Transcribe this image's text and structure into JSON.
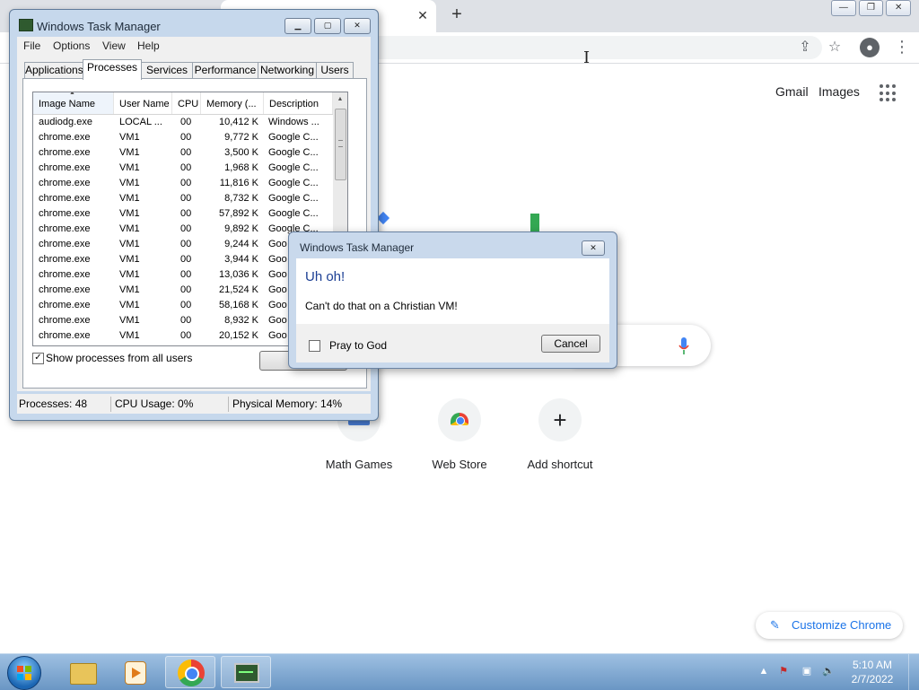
{
  "chrome": {
    "tab_close": "✕",
    "new_tab": "+",
    "window_controls": [
      "—",
      "❐",
      "✕"
    ],
    "links": {
      "gmail": "Gmail",
      "images": "Images"
    },
    "shortcuts": [
      {
        "label": "Math Games",
        "icon": "math-games-icon"
      },
      {
        "label": "Web Store",
        "icon": "web-store-icon"
      },
      {
        "label": "Add shortcut",
        "icon": "plus-icon",
        "glyph": "+"
      }
    ],
    "customize_label": "Customize Chrome",
    "colors": {
      "link_blue": "#1a73e8",
      "google_blue": "#4285f4",
      "google_green": "#34a853"
    }
  },
  "task_manager": {
    "title": "Windows Task Manager",
    "menu": [
      "File",
      "Options",
      "View",
      "Help"
    ],
    "tabs": [
      "Applications",
      "Processes",
      "Services",
      "Performance",
      "Networking",
      "Users"
    ],
    "active_tab": "Processes",
    "columns": [
      "Image Name",
      "User Name",
      "CPU",
      "Memory (...",
      "Description"
    ],
    "rows": [
      [
        "audiodg.exe",
        "LOCAL ...",
        "00",
        "10,412 K",
        "Windows ..."
      ],
      [
        "chrome.exe",
        "VM1",
        "00",
        "9,772 K",
        "Google C..."
      ],
      [
        "chrome.exe",
        "VM1",
        "00",
        "3,500 K",
        "Google C..."
      ],
      [
        "chrome.exe",
        "VM1",
        "00",
        "1,968 K",
        "Google C..."
      ],
      [
        "chrome.exe",
        "VM1",
        "00",
        "11,816 K",
        "Google C..."
      ],
      [
        "chrome.exe",
        "VM1",
        "00",
        "8,732 K",
        "Google C..."
      ],
      [
        "chrome.exe",
        "VM1",
        "00",
        "57,892 K",
        "Google C..."
      ],
      [
        "chrome.exe",
        "VM1",
        "00",
        "9,892 K",
        "Google C..."
      ],
      [
        "chrome.exe",
        "VM1",
        "00",
        "9,244 K",
        "Goo"
      ],
      [
        "chrome.exe",
        "VM1",
        "00",
        "3,944 K",
        "Goo"
      ],
      [
        "chrome.exe",
        "VM1",
        "00",
        "13,036 K",
        "Goo"
      ],
      [
        "chrome.exe",
        "VM1",
        "00",
        "21,524 K",
        "Goo"
      ],
      [
        "chrome.exe",
        "VM1",
        "00",
        "58,168 K",
        "Goo"
      ],
      [
        "chrome.exe",
        "VM1",
        "00",
        "8,932 K",
        "Goo"
      ],
      [
        "chrome.exe",
        "VM1",
        "00",
        "20,152 K",
        "Goo"
      ]
    ],
    "show_all_label": "Show processes from all users",
    "show_all_checked": true,
    "end_button": "En",
    "status": {
      "processes": "Processes: 48",
      "cpu": "CPU Usage: 0%",
      "memory": "Physical Memory: 14%"
    }
  },
  "dialog": {
    "title": "Windows Task Manager",
    "heading": "Uh oh!",
    "message": "Can't do that on a Christian VM!",
    "checkbox_label": "Pray to God",
    "cancel_label": "Cancel",
    "close_glyph": "✕",
    "colors": {
      "heading": "#1c3f94"
    }
  },
  "taskbar": {
    "time": "5:10 AM",
    "date": "2/7/2022",
    "tray_arrow": "▲"
  }
}
